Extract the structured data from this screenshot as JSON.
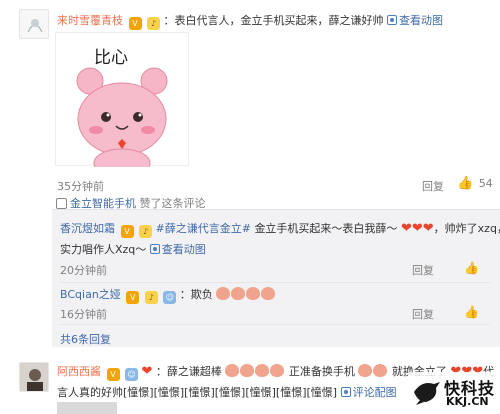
{
  "comment1": {
    "username": "来时雪覆青枝",
    "text": "：表白代言人，金立手机买起来，薛之谦好帅",
    "view_anim": "查看动图",
    "sticker_text": "比心",
    "time": "35分钟前",
    "from_prefix": "金立智能手机",
    "from_suffix": "赞了这条评论",
    "reply_label": "回复",
    "like_count": "54"
  },
  "replies": [
    {
      "username": "香沉煜如霜",
      "hashtag1": "#薛之谦代言金立#",
      "text1": "金立手机买起来～表白我薛～",
      "text2": "，帅炸了xzq，",
      "text3": "实力唱作人Xzq～",
      "view_anim": "查看动图",
      "time": "20分钟前",
      "reply_label": "回复"
    },
    {
      "username": "BCqian之娅",
      "text": "：欺负",
      "time": "16分钟前",
      "reply_label": "回复"
    }
  ],
  "reply_total": "共6条回复",
  "comment2": {
    "username": "阿西西酱",
    "text1": "：薛之谦超棒",
    "text2": "正准备换手机",
    "text3": "就换金立了",
    "text4": "代",
    "line2": "言人真的好帅[憧憬][憧憬][憧憬][憧憬][憧憬][憧憬][憧憬]",
    "view_anim": "评论配图"
  },
  "watermark": {
    "brand": "快科技",
    "domain": "KKJ.CN"
  },
  "colors": {
    "link": "#eb7350",
    "reply_bg": "#f2f2f5",
    "heart": "#e8452c"
  }
}
